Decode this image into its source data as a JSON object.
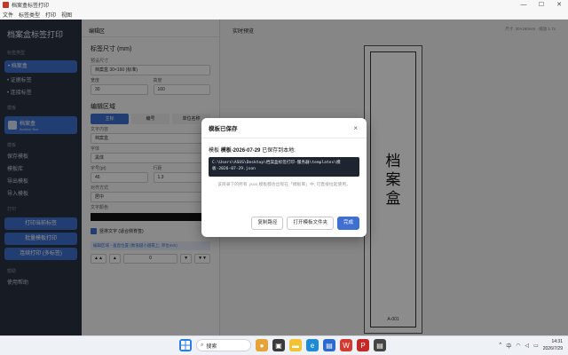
{
  "window": {
    "title": "档案盒标签打印",
    "controls": [
      "—",
      "☐",
      "✕"
    ]
  },
  "menu": [
    "文件",
    "标签类型",
    "打印",
    "视图"
  ],
  "sidebar": {
    "brand": "档案盒标签打印",
    "sections": {
      "types": "标签类型",
      "templates": "模板",
      "print": "打印",
      "help": "帮助"
    },
    "type_items": [
      "• 档案盒",
      "• 证据标签",
      "• 连接标签"
    ],
    "card_label": "档案盒",
    "card_sub": "Archive Box",
    "template_items": [
      "保存模板",
      "模板库",
      "导出模板",
      "导入模板"
    ],
    "print_buttons": [
      "打印当前标签",
      "批量模板打印",
      "连续打印 (多标签)"
    ],
    "help_items": [
      "使用帮助"
    ]
  },
  "editor": {
    "header": "编辑区",
    "size_title": "标签尺寸 (mm)",
    "preset_label": "预设尺寸",
    "preset_value": "档案盒 30×160 (标准)",
    "width_label": "宽度",
    "width_value": "30",
    "height_label": "高度",
    "height_value": "160",
    "content_title": "编辑区域",
    "tabs": [
      "主标",
      "编号",
      "单位名称"
    ],
    "text_label": "文字内容",
    "text_value": "档案盒",
    "font_label": "字体",
    "font_value": "黑体",
    "size_label": "字号(pt)",
    "size_value": "46",
    "spacing_label": "行距",
    "spacing_value": "1.3",
    "align_label": "对齐方式",
    "align_value": "居中",
    "color_label": "文字颜色",
    "vertical_check": "竖排文字 (适合侧脊签)",
    "hint": "编辑区域 - 垂直位置 (数值越小越靠上, 单位mm)",
    "stepper": [
      "▲▲",
      "▲",
      "0",
      "▼",
      "▼▼"
    ]
  },
  "preview": {
    "header": "实时预览",
    "meta": "尺寸: 30×160mm · 缩放 1.7x",
    "label_chars": [
      "档",
      "案",
      "盒"
    ],
    "label_code": "A-001"
  },
  "dialog": {
    "title": "模板已保存",
    "close": "×",
    "message_prefix": "模板",
    "message_name": "模板-2026-07-29",
    "message_suffix": "已保存到本地:",
    "path": "C:\\Users\\ASUS\\Desktop\\档案盒标签打印-服务器\\templates\\模板-2026-07-29.json",
    "note": "该目录下的所有 .json 模板都会出现在「模板库」中, 可直接拉起使用。",
    "buttons": {
      "copy": "复制路径",
      "open_folder": "打开模板文件夹",
      "done": "完成"
    }
  },
  "taskbar": {
    "search_placeholder": "搜索",
    "time": "14:31",
    "date": "2026/7/29",
    "ime": "中",
    "tray_up": "^"
  }
}
